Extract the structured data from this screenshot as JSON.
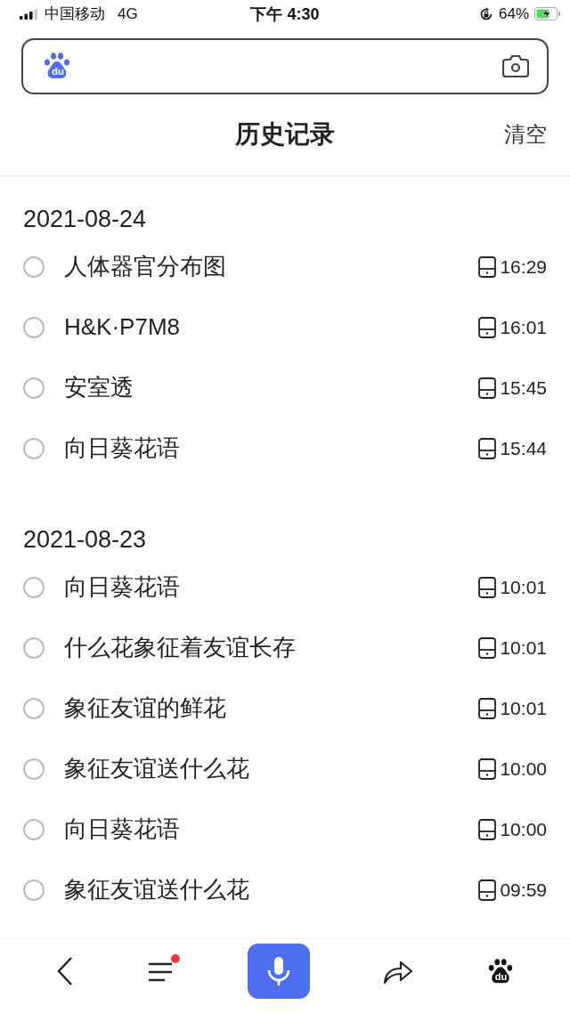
{
  "status_bar": {
    "carrier": "中国移动",
    "network": "4G",
    "time": "下午 4:30",
    "battery": "64%",
    "charging": true
  },
  "search": {
    "logo": "du"
  },
  "header": {
    "title": "历史记录",
    "clear": "清空"
  },
  "groups": [
    {
      "date": "2021-08-24",
      "items": [
        {
          "text": "人体器官分布图",
          "time": "16:29",
          "checked": false
        },
        {
          "text": "H&K·P7M8",
          "time": "16:01",
          "checked": false
        },
        {
          "text": "安室透",
          "time": "15:45",
          "checked": false
        },
        {
          "text": "向日葵花语",
          "time": "15:44",
          "checked": false
        }
      ]
    },
    {
      "date": "2021-08-23",
      "items": [
        {
          "text": "向日葵花语",
          "time": "10:01",
          "checked": false
        },
        {
          "text": "什么花象征着友谊长存",
          "time": "10:01",
          "checked": false
        },
        {
          "text": "象征友谊的鲜花",
          "time": "10:01",
          "checked": false
        },
        {
          "text": "象征友谊送什么花",
          "time": "10:00",
          "checked": false
        },
        {
          "text": "向日葵花语",
          "time": "10:00",
          "checked": false
        },
        {
          "text": "象征友谊送什么花",
          "time": "09:59",
          "checked": false
        }
      ]
    }
  ],
  "bottom_bar": {
    "menu_badge": true,
    "logo": "du"
  }
}
